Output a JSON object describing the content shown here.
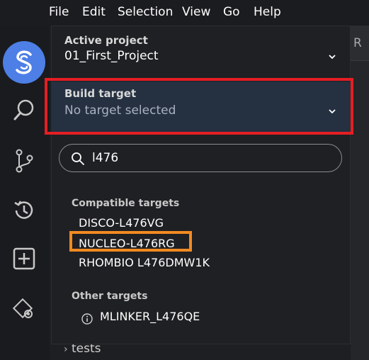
{
  "menu": [
    "File",
    "Edit",
    "Selection",
    "View",
    "Go",
    "Help"
  ],
  "activity_icons": [
    "studio-logo-icon",
    "search-icon",
    "source-control-icon",
    "history-icon",
    "add-icon",
    "settings-icon"
  ],
  "editor_tab": {
    "label": "R"
  },
  "panel": {
    "active_project": {
      "label": "Active project",
      "value": "01_First_Project"
    },
    "build_target": {
      "label": "Build target",
      "value": "No target selected"
    },
    "search": {
      "value": "l476"
    },
    "compatible": {
      "label": "Compatible targets",
      "items": [
        "DISCO-L476VG",
        "NUCLEO-L476RG",
        "RHOMBIO L476DMW1K"
      ]
    },
    "other": {
      "label": "Other targets",
      "items": [
        "MLINKER_L476QE"
      ]
    }
  },
  "explorer": {
    "item": "tests"
  },
  "colors": {
    "accent": "#4d7fe6",
    "highlight_red": "#e51e25",
    "highlight_orange": "#f28a22"
  }
}
